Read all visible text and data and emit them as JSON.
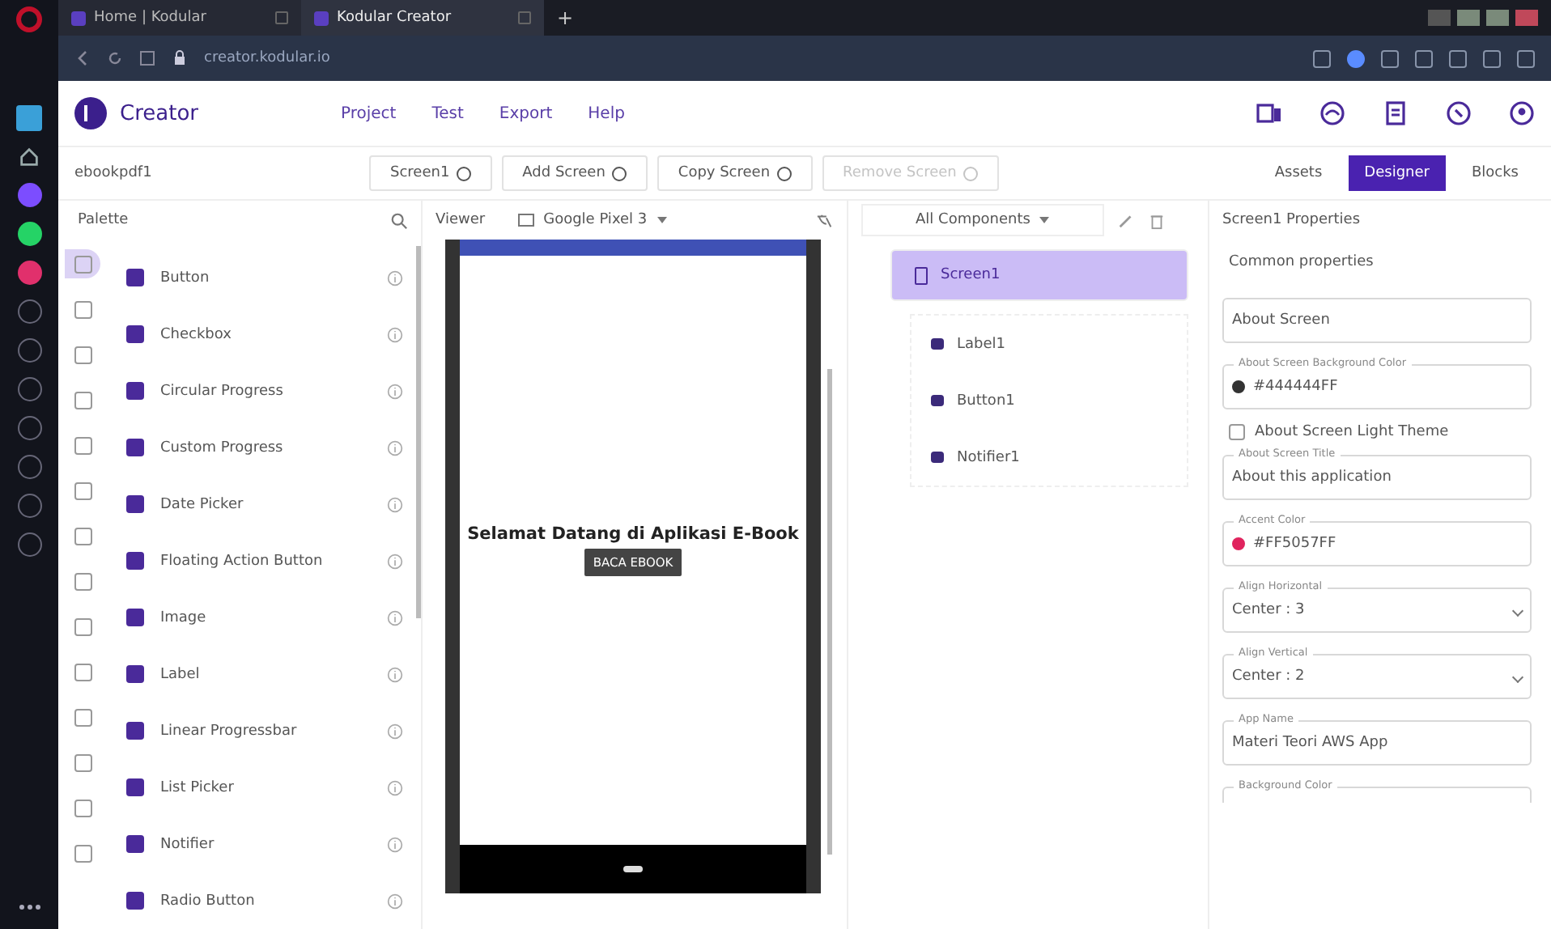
{
  "browser": {
    "tabs": [
      {
        "title": "Home | Kodular",
        "selected": false
      },
      {
        "title": "Kodular Creator",
        "selected": true
      }
    ],
    "new_tab": "+",
    "url": "creator.kodular.io"
  },
  "app": {
    "logo": "Creator",
    "menu": [
      "Project",
      "Test",
      "Export",
      "Help"
    ]
  },
  "toolbar": {
    "project": "ebookpdf1",
    "screen": "Screen1",
    "buttons": [
      {
        "label": "Add Screen",
        "disabled": false
      },
      {
        "label": "Copy Screen",
        "disabled": false
      },
      {
        "label": "Remove Screen",
        "disabled": true
      }
    ],
    "views": [
      {
        "label": "Assets",
        "selected": false
      },
      {
        "label": "Designer",
        "selected": true
      },
      {
        "label": "Blocks",
        "selected": false
      }
    ]
  },
  "palette": {
    "title": "Palette",
    "categories": [
      {
        "selected": true
      },
      {
        "selected": false
      },
      {
        "selected": false
      },
      {
        "selected": false
      },
      {
        "selected": false
      },
      {
        "selected": false
      },
      {
        "selected": false
      },
      {
        "selected": false
      },
      {
        "selected": false
      },
      {
        "selected": false
      },
      {
        "selected": false
      },
      {
        "selected": false
      },
      {
        "selected": false
      },
      {
        "selected": false
      }
    ],
    "items": [
      "Button",
      "Checkbox",
      "Circular Progress",
      "Custom Progress",
      "Date Picker",
      "Floating Action Button",
      "Image",
      "Label",
      "Linear Progressbar",
      "List Picker",
      "Notifier",
      "Radio Button"
    ]
  },
  "viewer": {
    "label": "Viewer",
    "device": "Google Pixel 3",
    "phone": {
      "label": "Selamat Datang di Aplikasi E-Book",
      "button": "BACA EBOOK"
    }
  },
  "components": {
    "filter": "All Components",
    "tree": [
      {
        "name": "Screen1",
        "selected": true,
        "children": [
          {
            "name": "Label1",
            "selected": false
          },
          {
            "name": "Button1",
            "selected": false
          },
          {
            "name": "Notifier1",
            "selected": false
          }
        ]
      }
    ]
  },
  "properties": {
    "title": "Screen1 Properties",
    "section": "Common properties",
    "fields": [
      {
        "kind": "text",
        "value": "About Screen"
      },
      {
        "kind": "color",
        "label": "About Screen Background Color",
        "value": "#444444FF",
        "color": "#333333"
      },
      {
        "kind": "checkbox",
        "label": "About Screen Light Theme",
        "checked": false
      },
      {
        "kind": "text",
        "label": "About Screen Title",
        "value": "About this application"
      },
      {
        "kind": "color",
        "label": "Accent Color",
        "value": "#FF5057FF",
        "color": "#e0245e"
      },
      {
        "kind": "select",
        "label": "Align Horizontal",
        "value": "Center : 3"
      },
      {
        "kind": "select",
        "label": "Align Vertical",
        "value": "Center : 2"
      },
      {
        "kind": "text",
        "label": "App Name",
        "value": "Materi Teori AWS App"
      },
      {
        "kind": "partial",
        "label": "Background Color"
      }
    ]
  }
}
